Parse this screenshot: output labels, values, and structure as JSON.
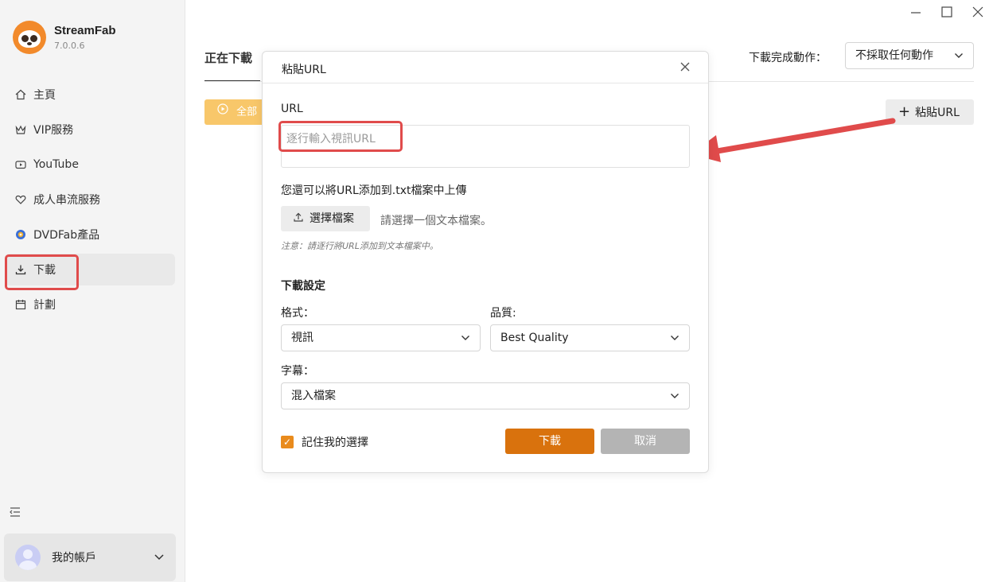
{
  "app": {
    "name": "StreamFab",
    "version": "7.0.0.6"
  },
  "sidebar": {
    "items": [
      {
        "label": "主頁",
        "icon": "home-icon"
      },
      {
        "label": "VIP服務",
        "icon": "vip-icon"
      },
      {
        "label": "YouTube",
        "icon": "youtube-icon"
      },
      {
        "label": "成人串流服務",
        "icon": "heart-icon"
      },
      {
        "label": "DVDFab產品",
        "icon": "dvdfab-icon"
      },
      {
        "label": "下載",
        "icon": "download-icon",
        "active": true
      },
      {
        "label": "計劃",
        "icon": "calendar-icon"
      }
    ],
    "account_label": "我的帳戶"
  },
  "main": {
    "tab_label": "正在下載",
    "after_download_label": "下載完成動作：",
    "after_download_value": "不採取任何動作",
    "start_all_label": "全部",
    "paste_url_label": "粘貼URL"
  },
  "dialog": {
    "title": "粘貼URL",
    "url_label": "URL",
    "url_placeholder": "逐行輸入視訊URL",
    "txt_hint": "您還可以將URL添加到.txt檔案中上傳",
    "choose_file_label": "選擇檔案",
    "choose_file_hint": "請選擇一個文本檔案。",
    "note": "注意：請逐行將URL添加到文本檔案中。",
    "settings_title": "下載設定",
    "format_label": "格式：",
    "format_value": "視訊",
    "quality_label": "品質:",
    "quality_value": "Best Quality",
    "subtitle_label": "字幕：",
    "subtitle_value": "混入檔案",
    "remember_label": "記住我的選擇",
    "remember_checked": true,
    "download_label": "下載",
    "cancel_label": "取消"
  },
  "colors": {
    "accent": "#d9720d",
    "highlight": "#e04b4b",
    "checkbox": "#e98b1c",
    "start_all_bg": "#f8c76a"
  }
}
